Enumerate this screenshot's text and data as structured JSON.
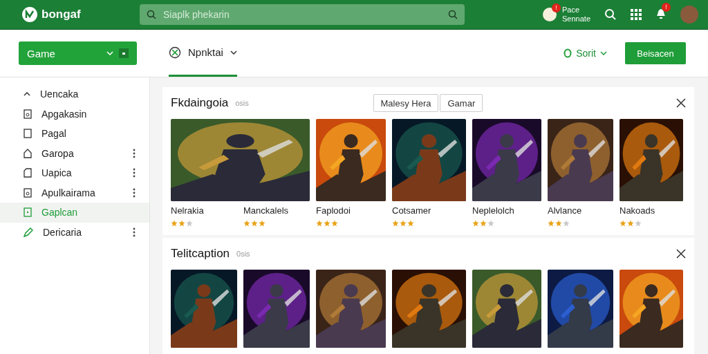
{
  "header": {
    "logo_text": "bongaf",
    "search": {
      "placeholder": "Siaplk phekarin"
    },
    "notice": {
      "badge": "!",
      "line_1": "Pace",
      "line_2": "Sennate"
    },
    "bell_badge": "!"
  },
  "toolbar": {
    "category_button": "Game",
    "tab": {
      "label": "Npnktai",
      "selected": true
    },
    "sort": "Sorit",
    "action_button": "Beisacen"
  },
  "sidebar": {
    "items": [
      {
        "label": "Uencaka",
        "menu": false,
        "selected": false
      },
      {
        "label": "Apgakasin",
        "menu": false,
        "selected": false
      },
      {
        "label": "Pagal",
        "menu": false,
        "selected": false
      },
      {
        "label": "Garopa",
        "menu": true,
        "selected": false
      },
      {
        "label": "Uapica",
        "menu": true,
        "selected": false
      },
      {
        "label": "Apulkairama",
        "menu": true,
        "selected": false
      },
      {
        "label": "Gaplcan",
        "menu": false,
        "selected": true
      },
      {
        "label": "Dericaria",
        "menu": true,
        "selected": false
      }
    ]
  },
  "sections": [
    {
      "title": "Fkdaingoia",
      "count": "osis",
      "buttons": [
        "Malesy Hera",
        "Gamar"
      ],
      "items": [
        {
          "kind": "wide",
          "name": "Nelrakia",
          "stars": 2
        },
        {
          "kind": "under_wide",
          "name": "Manckalels",
          "stars": 3
        },
        {
          "kind": "tile",
          "name": "Faplodoi",
          "stars": 3
        },
        {
          "kind": "tile",
          "name": "Cotsamer",
          "stars": 3
        },
        {
          "kind": "tile",
          "name": "Neplelolch",
          "stars": 2
        },
        {
          "kind": "tile",
          "name": "Alvlance",
          "stars": 2
        },
        {
          "kind": "tile",
          "name": "Nakoads",
          "stars": 2
        }
      ]
    },
    {
      "title": "Telitcaption",
      "count": "0sis",
      "items": [
        {
          "kind": "tile"
        },
        {
          "kind": "tile"
        },
        {
          "kind": "tile"
        },
        {
          "kind": "tile"
        },
        {
          "kind": "tile"
        },
        {
          "kind": "tile"
        },
        {
          "kind": "tile"
        }
      ]
    }
  ]
}
